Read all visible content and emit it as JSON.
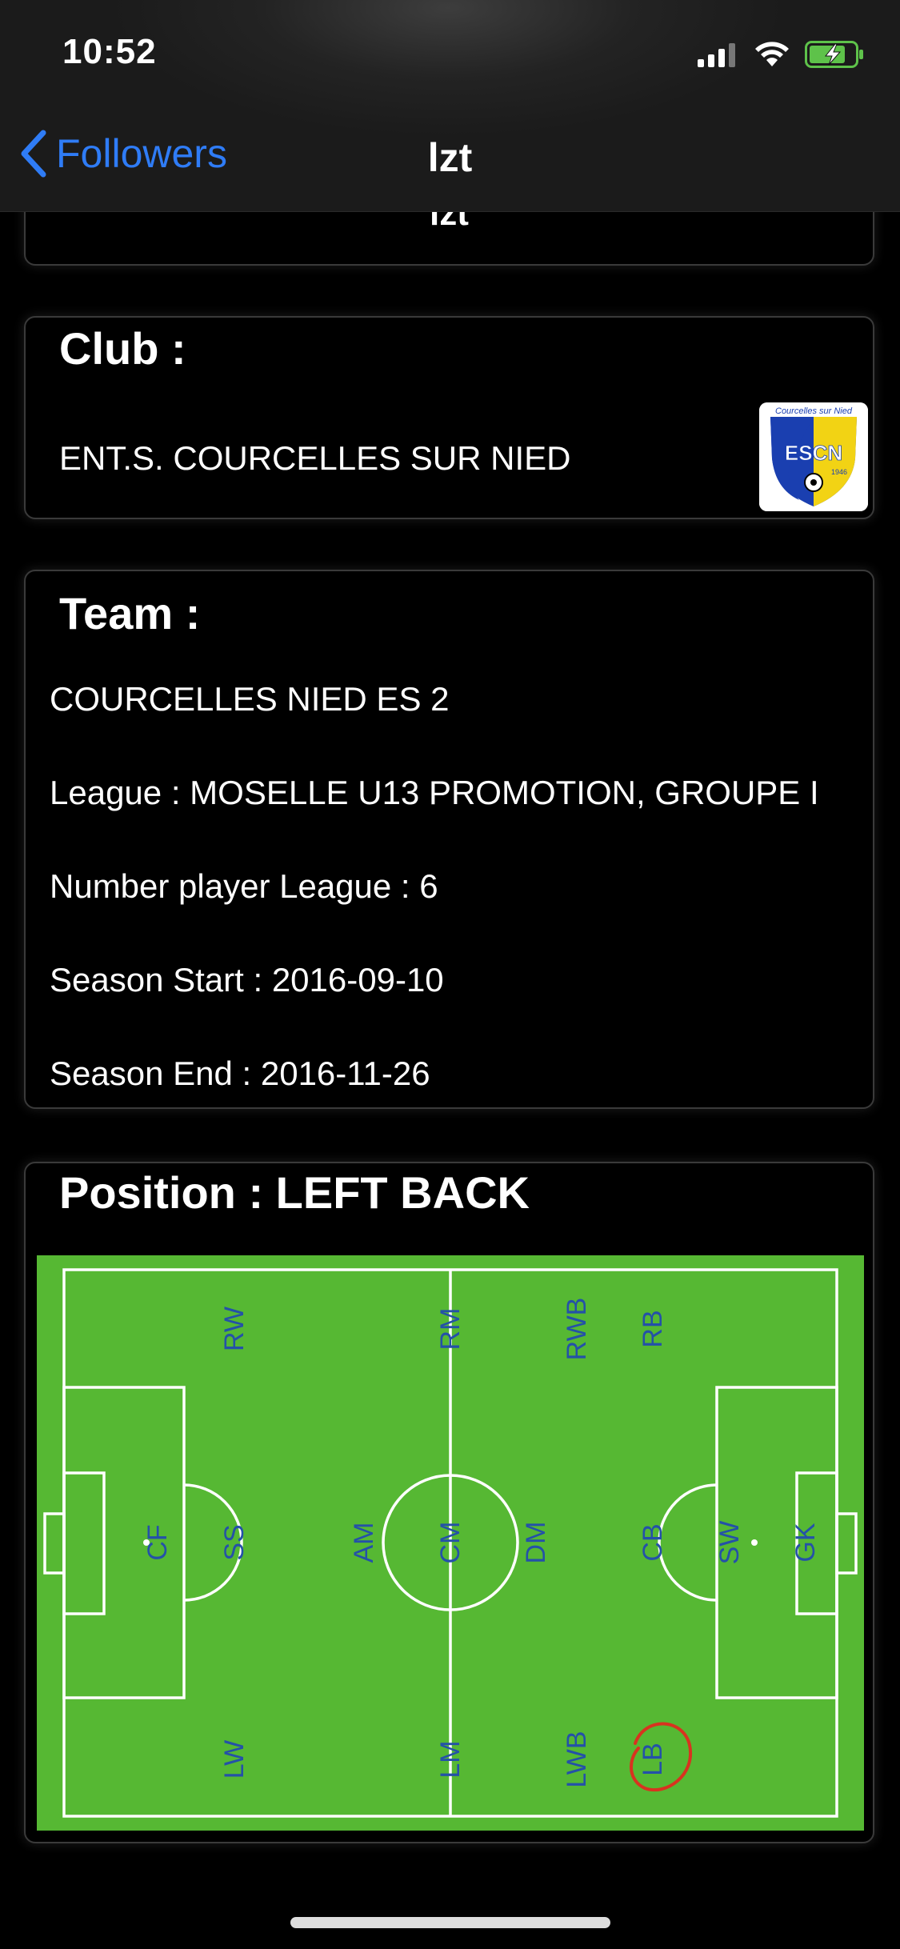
{
  "status_bar": {
    "time": "10:52"
  },
  "nav": {
    "back_label": "Followers",
    "title": "lzt"
  },
  "profile_card": {
    "name": "lzt"
  },
  "club": {
    "title": "Club :",
    "name": "ENT.S. COURCELLES SUR NIED",
    "logo": {
      "top_text": "Courcelles sur Nied",
      "letters": "ESCN",
      "year": "1946",
      "colors": [
        "#1a3fb0",
        "#f2d314"
      ]
    }
  },
  "team": {
    "title": "Team :",
    "name": "COURCELLES NIED ES 2",
    "league": "League : MOSELLE U13 PROMOTION, GROUPE I",
    "number_players": "Number player League :  6",
    "season_start": "Season Start :  2016-09-10",
    "season_end": "Season End :  2016-11-26"
  },
  "position": {
    "title": "Position : LEFT BACK",
    "selected": "LB",
    "labels": {
      "RW": "RW",
      "RM": "RM",
      "RWB": "RWB",
      "RB": "RB",
      "CF": "CF",
      "SS": "SS",
      "AM": "AM",
      "CM": "CM",
      "DM": "DM",
      "CB": "CB",
      "SW": "SW",
      "GK": "GK",
      "LW": "LW",
      "LM": "LM",
      "LWB": "LWB",
      "LB": "LB"
    },
    "colors": {
      "pitch": "#56b833",
      "lines": "#ffffff",
      "labels": "#2451a8",
      "highlight": "#d8331f"
    }
  }
}
